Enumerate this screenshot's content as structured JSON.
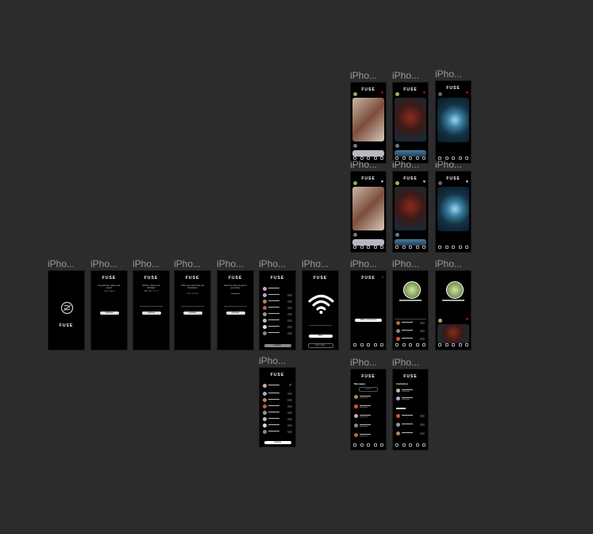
{
  "frames": {
    "f_top1": {
      "label": "iPho..."
    },
    "f_top2": {
      "label": "iPho..."
    },
    "f_top3": {
      "label": "iPho..."
    },
    "f_mid1": {
      "label": "iPho..."
    },
    "f_mid2": {
      "label": "iPho..."
    },
    "f_mid3": {
      "label": "iPho..."
    },
    "f_r1": {
      "label": "iPho..."
    },
    "f_r2": {
      "label": "iPho..."
    },
    "f_r3": {
      "label": "iPho..."
    },
    "f_r4": {
      "label": "iPho..."
    },
    "f_r5": {
      "label": "iPho..."
    },
    "f_r6": {
      "label": "iPho..."
    },
    "f_r7": {
      "label": "iPho..."
    },
    "f_r8": {
      "label": "iPho..."
    },
    "f_r9": {
      "label": "iPho..."
    },
    "f_r10": {
      "label": "iPho..."
    },
    "f_r11": {
      "label": "iPho..."
    },
    "f_low1": {
      "label": "iPho..."
    },
    "f_bot1": {
      "label": "iPho..."
    },
    "f_bot2": {
      "label": "iPho..."
    }
  },
  "app": {
    "logo": "FUSE",
    "input_name": "Your name",
    "input_date": "MM DD YYYY",
    "input_phone": "Your phone",
    "continue": "continue",
    "allow": "Allow",
    "dont_allow": "Don't allow",
    "make_connections": "Make connections",
    "messages": "Messages",
    "invitations": "Invitations",
    "search": "Search",
    "q_name": "we gotta ask, what's your name?",
    "q_birthday": "Mmmm, what's your birthday?",
    "q_phone": "I think you need to log your information",
    "q_code": "Enter the code we sent to your phone"
  },
  "colors": {
    "canvas": "#2c2c2c",
    "frame": "#000000",
    "label": "#9a9a9a",
    "accent_red": "#e22233"
  }
}
